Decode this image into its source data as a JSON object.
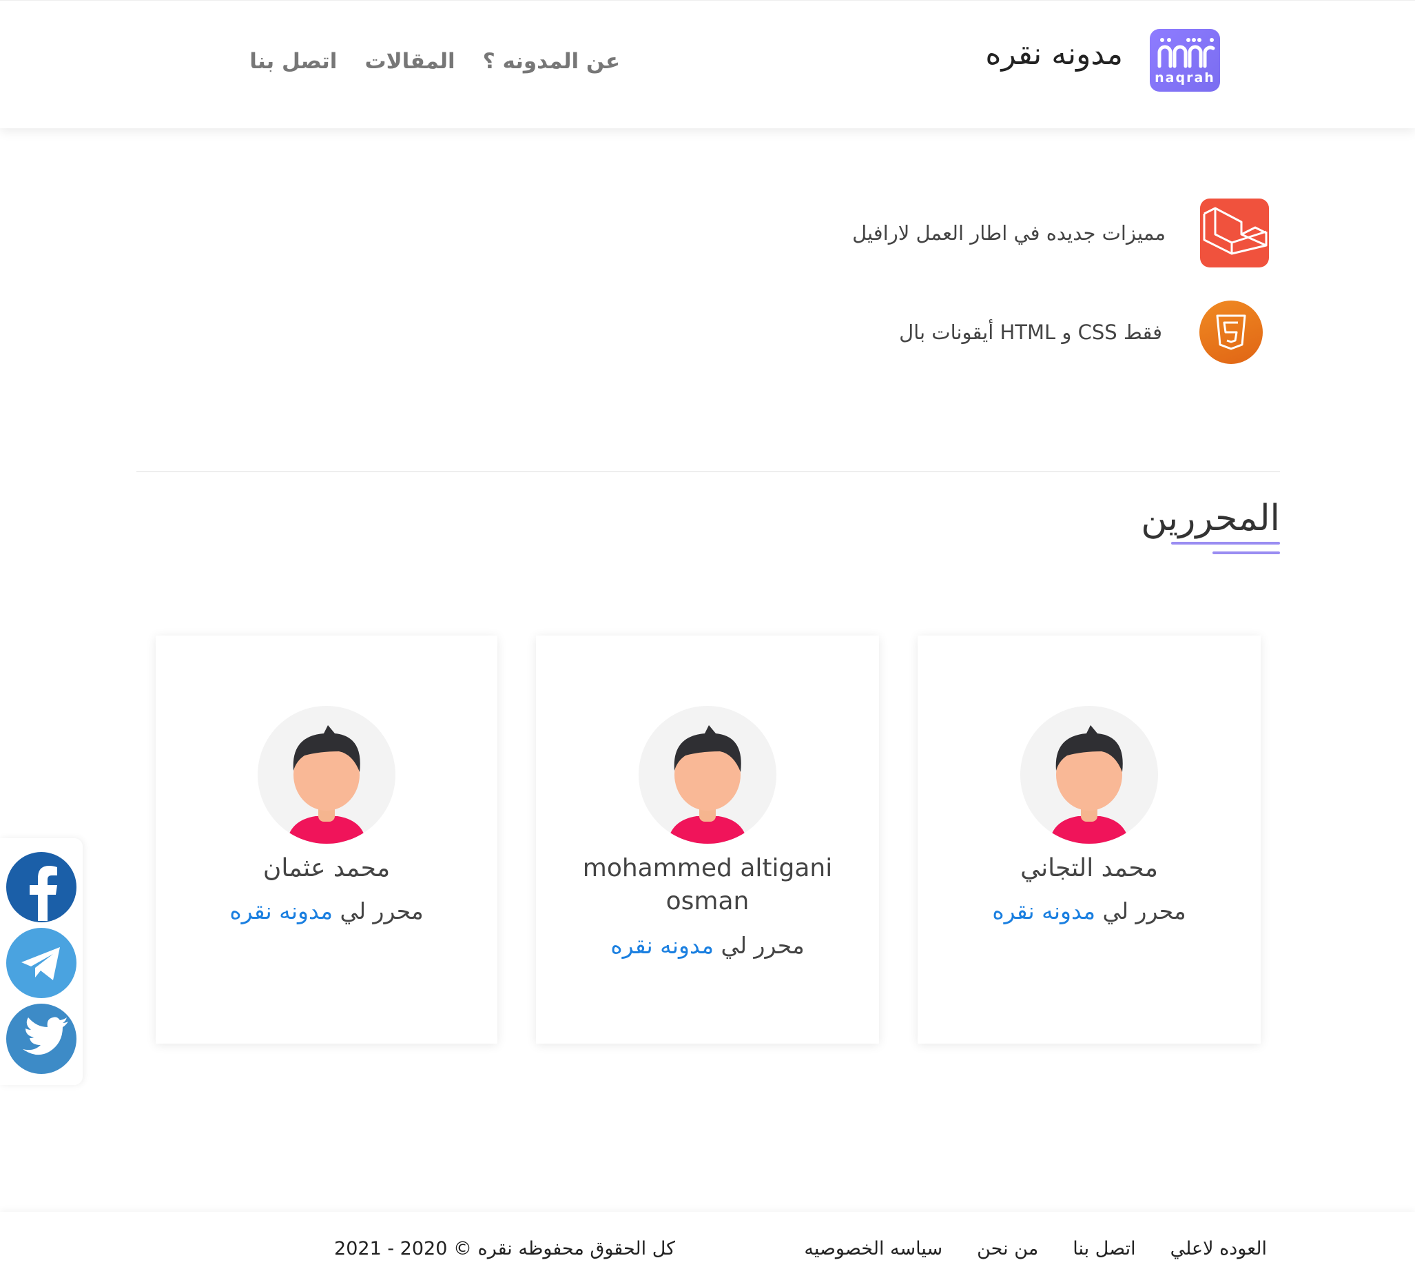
{
  "header": {
    "brand_name": "مدونه نقره",
    "logo_text": "naqrah",
    "nav": [
      {
        "label": "عن المدونه ؟"
      },
      {
        "label": "المقالات"
      },
      {
        "label": "اتصل بنا"
      }
    ]
  },
  "features": [
    {
      "icon": "laravel-icon",
      "text": "مميزات جديده في اطار العمل لارافيل"
    },
    {
      "icon": "html5-icon",
      "text": "فقط CSS و HTML أيقونات بال"
    }
  ],
  "editors_section": {
    "title": "المحررين",
    "cards": [
      {
        "name": "محمد التجاني",
        "role_prefix": "محرر لي",
        "role_link": "مدونه نقره"
      },
      {
        "name": "mohammed altigani osman",
        "role_prefix": "محرر لي",
        "role_link": "مدونه نقره"
      },
      {
        "name": "محمد عثمان",
        "role_prefix": "محرر لي",
        "role_link": "مدونه نقره"
      }
    ]
  },
  "social": [
    {
      "icon": "facebook-icon",
      "color": "#1b5fa8"
    },
    {
      "icon": "telegram-icon",
      "color": "#4aa3e0"
    },
    {
      "icon": "twitter-icon",
      "color": "#3d8bc7"
    }
  ],
  "footer": {
    "links": [
      "العوده لاعلي",
      "اتصل بنا",
      "من نحن",
      "سياسه الخصوصيه"
    ],
    "copyright": "كل الحقوق محفوظه نقره © 2020 - 2021"
  },
  "colors": {
    "accent": "#9a8df2",
    "link": "#1a7fe0",
    "laravel": "#f0523d",
    "html5": "#e8761c"
  }
}
